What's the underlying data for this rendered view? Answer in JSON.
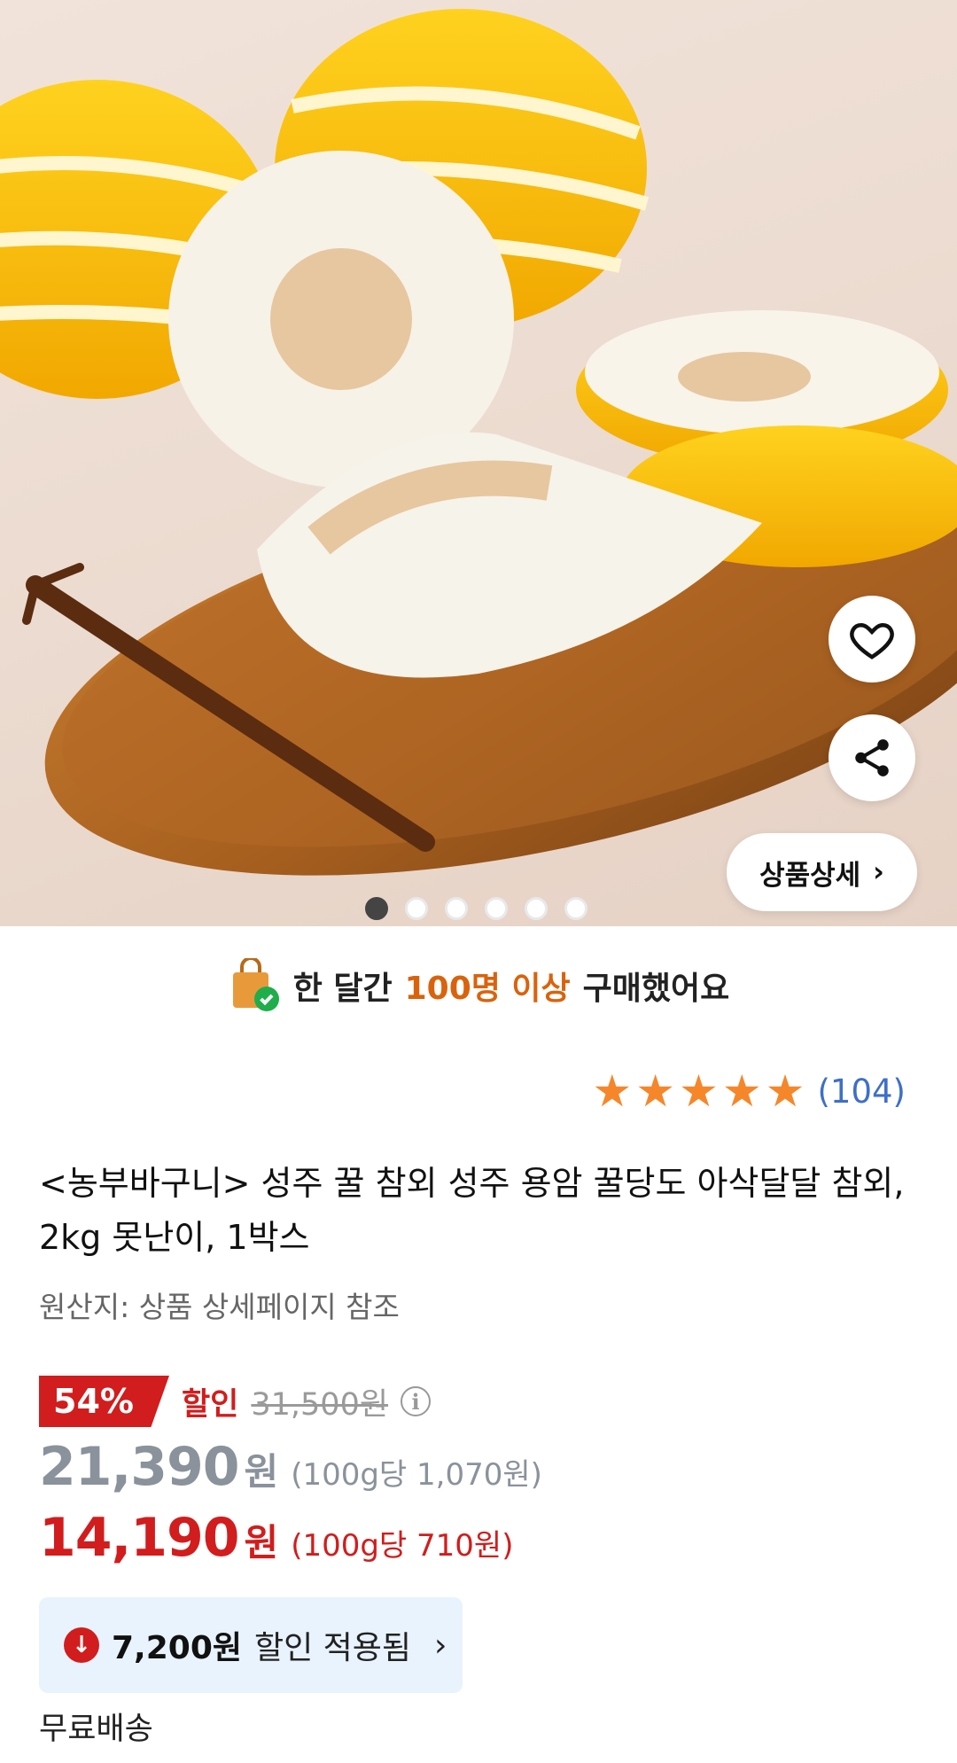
{
  "product_images": {
    "current_index": 1,
    "total": 6
  },
  "actions": {
    "wishlist_icon": "heart-icon",
    "share_icon": "share-icon",
    "detail_label": "상품상세"
  },
  "buyers": {
    "prefix": "한 달간",
    "highlight": "100명 이상",
    "suffix": "구매했어요"
  },
  "rating": {
    "stars": 5,
    "review_count": "(104)"
  },
  "product": {
    "title": "<농부바구니> 성주 꿀 참외 성주 용암 꿀당도 아삭달달 참외, 2kg 못난이, 1박스",
    "origin": "원산지: 상품 상세페이지 참조"
  },
  "pricing": {
    "discount_percent": "54%",
    "discount_label": "할인",
    "original_price": "31,500원",
    "sale_price": "21,390",
    "sale_unit": "원",
    "sale_unit_price": "(100g당 1,070원)",
    "final_price": "14,190",
    "final_unit": "원",
    "final_unit_price": "(100g당 710원)"
  },
  "coupon": {
    "amount": "7,200원",
    "label": "할인 적용됨"
  },
  "shipping": {
    "label": "무료배송"
  },
  "colors": {
    "accent_red": "#d11d1d",
    "star_orange": "#f5872a",
    "buyer_highlight": "#d9630d",
    "link_blue": "#3f6fc8",
    "coupon_bg": "#e8f3fd"
  }
}
